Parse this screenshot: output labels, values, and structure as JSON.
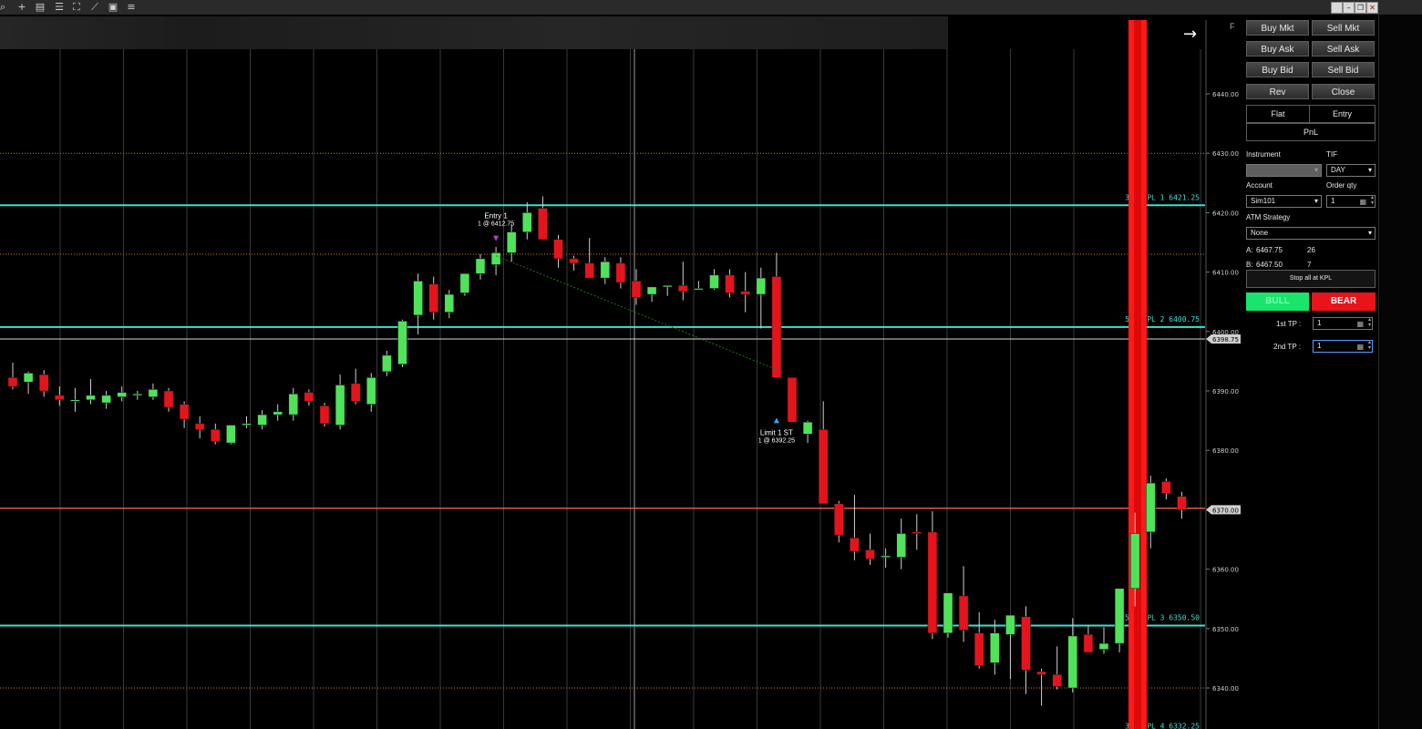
{
  "toolbar": {
    "icons": [
      "search-icon",
      "crosshair-icon",
      "document-icon",
      "properties-icon",
      "zoom-icon",
      "draw-icon",
      "print-icon",
      "list-icon"
    ]
  },
  "chart_data": {
    "type": "candlestick",
    "price_axis": {
      "ticks": [
        "6440.00",
        "6430.00",
        "6420.00",
        "6410.00",
        "6400.00",
        "6390.00",
        "6380.00",
        "6370.00",
        "6360.00",
        "6350.00",
        "6340.00"
      ],
      "range": [
        6328,
        6450
      ],
      "markers": [
        {
          "label": "6398.75",
          "price": 6398.75
        },
        {
          "label": "6370.00",
          "price": 6370.0
        }
      ]
    },
    "candles": [
      {
        "o": 6392.25,
        "h": 6394.75,
        "l": 6390.25,
        "c": 6390.75
      },
      {
        "o": 6391.5,
        "h": 6393.25,
        "l": 6389.5,
        "c": 6393.0
      },
      {
        "o": 6392.75,
        "h": 6393.5,
        "l": 6389.0,
        "c": 6390.0
      },
      {
        "o": 6389.25,
        "h": 6390.75,
        "l": 6387.5,
        "c": 6388.5
      },
      {
        "o": 6388.5,
        "h": 6390.5,
        "l": 6386.5,
        "c": 6388.5
      },
      {
        "o": 6388.5,
        "h": 6392.0,
        "l": 6387.75,
        "c": 6389.25
      },
      {
        "o": 6388.0,
        "h": 6390.0,
        "l": 6387.0,
        "c": 6389.25
      },
      {
        "o": 6389.0,
        "h": 6390.75,
        "l": 6388.25,
        "c": 6389.75
      },
      {
        "o": 6389.25,
        "h": 6390.0,
        "l": 6388.5,
        "c": 6389.5
      },
      {
        "o": 6389.0,
        "h": 6391.25,
        "l": 6388.5,
        "c": 6390.25
      },
      {
        "o": 6390.0,
        "h": 6390.5,
        "l": 6386.5,
        "c": 6387.25
      },
      {
        "o": 6387.75,
        "h": 6388.25,
        "l": 6383.75,
        "c": 6385.25
      },
      {
        "o": 6384.5,
        "h": 6385.75,
        "l": 6382.0,
        "c": 6383.5
      },
      {
        "o": 6383.5,
        "h": 6384.5,
        "l": 6381.0,
        "c": 6381.5
      },
      {
        "o": 6381.25,
        "h": 6384.25,
        "l": 6381.0,
        "c": 6384.25
      },
      {
        "o": 6384.25,
        "h": 6385.75,
        "l": 6383.75,
        "c": 6384.5
      },
      {
        "o": 6384.25,
        "h": 6386.75,
        "l": 6383.5,
        "c": 6386.0
      },
      {
        "o": 6386.0,
        "h": 6387.75,
        "l": 6385.0,
        "c": 6386.5
      },
      {
        "o": 6386.0,
        "h": 6390.5,
        "l": 6385.0,
        "c": 6389.5
      },
      {
        "o": 6389.75,
        "h": 6390.25,
        "l": 6387.5,
        "c": 6388.25
      },
      {
        "o": 6387.5,
        "h": 6388.0,
        "l": 6384.0,
        "c": 6384.5
      },
      {
        "o": 6384.25,
        "h": 6392.75,
        "l": 6383.5,
        "c": 6391.0
      },
      {
        "o": 6391.25,
        "h": 6393.75,
        "l": 6387.75,
        "c": 6388.25
      },
      {
        "o": 6387.75,
        "h": 6393.0,
        "l": 6386.5,
        "c": 6392.25
      },
      {
        "o": 6393.25,
        "h": 6396.75,
        "l": 6392.5,
        "c": 6396.0
      },
      {
        "o": 6394.5,
        "h": 6402.0,
        "l": 6394.0,
        "c": 6401.75
      },
      {
        "o": 6402.75,
        "h": 6409.75,
        "l": 6399.5,
        "c": 6408.5
      },
      {
        "o": 6408.0,
        "h": 6409.25,
        "l": 6402.0,
        "c": 6403.25
      },
      {
        "o": 6403.25,
        "h": 6407.0,
        "l": 6402.25,
        "c": 6406.25
      },
      {
        "o": 6406.5,
        "h": 6409.0,
        "l": 6406.0,
        "c": 6409.75
      },
      {
        "o": 6409.75,
        "h": 6413.0,
        "l": 6408.75,
        "c": 6412.25
      },
      {
        "o": 6411.25,
        "h": 6414.25,
        "l": 6409.5,
        "c": 6413.25
      },
      {
        "o": 6413.25,
        "h": 6418.0,
        "l": 6411.75,
        "c": 6416.75
      },
      {
        "o": 6416.75,
        "h": 6421.75,
        "l": 6415.5,
        "c": 6420.0
      },
      {
        "o": 6420.75,
        "h": 6422.75,
        "l": 6416.25,
        "c": 6415.5
      },
      {
        "o": 6415.5,
        "h": 6416.25,
        "l": 6410.75,
        "c": 6412.25
      },
      {
        "o": 6412.25,
        "h": 6412.75,
        "l": 6410.25,
        "c": 6411.5
      },
      {
        "o": 6411.5,
        "h": 6415.75,
        "l": 6409.0,
        "c": 6409.0
      },
      {
        "o": 6409.0,
        "h": 6412.5,
        "l": 6408.0,
        "c": 6411.75
      },
      {
        "o": 6411.5,
        "h": 6412.5,
        "l": 6407.25,
        "c": 6408.25
      },
      {
        "o": 6408.5,
        "h": 6410.5,
        "l": 6404.5,
        "c": 6405.75
      },
      {
        "o": 6406.25,
        "h": 6407.5,
        "l": 6405.0,
        "c": 6407.5
      },
      {
        "o": 6407.5,
        "h": 6407.75,
        "l": 6406.0,
        "c": 6407.75
      },
      {
        "o": 6407.75,
        "h": 6411.75,
        "l": 6405.25,
        "c": 6406.75
      },
      {
        "o": 6407.25,
        "h": 6408.5,
        "l": 6407.25,
        "c": 6407.25
      },
      {
        "o": 6407.25,
        "h": 6410.5,
        "l": 6407.0,
        "c": 6409.5
      },
      {
        "o": 6409.5,
        "h": 6410.5,
        "l": 6405.75,
        "c": 6406.5
      },
      {
        "o": 6406.75,
        "h": 6410.0,
        "l": 6403.25,
        "c": 6406.25
      },
      {
        "o": 6406.25,
        "h": 6410.75,
        "l": 6400.5,
        "c": 6409.0
      },
      {
        "o": 6409.25,
        "h": 6413.25,
        "l": 6392.25,
        "c": 6392.25
      },
      {
        "o": 6392.25,
        "h": 6392.25,
        "l": 6384.75,
        "c": 6384.75
      },
      {
        "o": 6382.75,
        "h": 6385.0,
        "l": 6381.25,
        "c": 6384.75
      },
      {
        "o": 6383.5,
        "h": 6388.25,
        "l": 6371.0,
        "c": 6371.0
      },
      {
        "o": 6371.0,
        "h": 6371.5,
        "l": 6364.5,
        "c": 6365.75
      },
      {
        "o": 6365.25,
        "h": 6372.5,
        "l": 6361.5,
        "c": 6363.0
      },
      {
        "o": 6363.25,
        "h": 6366.0,
        "l": 6360.75,
        "c": 6361.75
      },
      {
        "o": 6362.0,
        "h": 6363.5,
        "l": 6360.25,
        "c": 6362.25
      },
      {
        "o": 6362.0,
        "h": 6368.5,
        "l": 6360.0,
        "c": 6366.0
      },
      {
        "o": 6366.25,
        "h": 6369.25,
        "l": 6363.25,
        "c": 6366.0
      },
      {
        "o": 6366.25,
        "h": 6369.75,
        "l": 6348.25,
        "c": 6349.25
      },
      {
        "o": 6349.25,
        "h": 6356.0,
        "l": 6348.5,
        "c": 6356.0
      },
      {
        "o": 6355.5,
        "h": 6360.5,
        "l": 6347.75,
        "c": 6349.75
      },
      {
        "o": 6349.25,
        "h": 6352.75,
        "l": 6343.25,
        "c": 6343.75
      },
      {
        "o": 6344.25,
        "h": 6351.5,
        "l": 6342.25,
        "c": 6349.25
      },
      {
        "o": 6349.0,
        "h": 6352.0,
        "l": 6341.5,
        "c": 6352.25
      },
      {
        "o": 6352.0,
        "h": 6353.75,
        "l": 6339.0,
        "c": 6343.0
      },
      {
        "o": 6342.75,
        "h": 6343.25,
        "l": 6337.0,
        "c": 6342.25
      },
      {
        "o": 6342.25,
        "h": 6347.0,
        "l": 6339.75,
        "c": 6340.25
      },
      {
        "o": 6340.0,
        "h": 6351.75,
        "l": 6339.25,
        "c": 6348.75
      },
      {
        "o": 6349.0,
        "h": 6350.5,
        "l": 6346.25,
        "c": 6346.0
      },
      {
        "o": 6346.5,
        "h": 6350.25,
        "l": 6345.75,
        "c": 6347.5
      },
      {
        "o": 6347.5,
        "h": 6355.25,
        "l": 6346.0,
        "c": 6356.75
      },
      {
        "o": 6356.75,
        "h": 6369.5,
        "l": 6353.75,
        "c": 6366.0
      },
      {
        "o": 6366.25,
        "h": 6375.75,
        "l": 6363.5,
        "c": 6374.5
      },
      {
        "o": 6374.75,
        "h": 6375.25,
        "l": 6371.75,
        "c": 6372.75
      },
      {
        "o": 6372.25,
        "h": 6373.0,
        "l": 6368.5,
        "c": 6370.0
      }
    ],
    "kpl_levels": [
      {
        "label": "32% KPL 1 6421.25",
        "price": 6421.25
      },
      {
        "label": "59% KPL 2 6400.75",
        "price": 6400.75
      },
      {
        "label": "55% KPL 3 6350.50",
        "price": 6350.5
      },
      {
        "label": "32% KPL 4 6332.25",
        "price": 6332.25
      }
    ],
    "dotted_levels": [
      6430.0,
      6413.0,
      6340.0
    ],
    "solid_levels": [
      6398.75
    ],
    "current_price_line": {
      "price": 6370.25,
      "label": "6370.00"
    },
    "order_markers": [
      {
        "label": "Entry 1",
        "detail": "1 @ 6412.75",
        "price": 6412.75
      },
      {
        "label": "Limit 1 ST",
        "detail": "1 @ 6392.25",
        "price": 6392.25
      }
    ],
    "grid": true,
    "highlight_band": "red vertical band near right edge"
  },
  "panel": {
    "buttons": [
      "Buy Mkt",
      "Sell Mkt",
      "Buy Ask",
      "Sell Ask",
      "Buy Bid",
      "Sell Bid",
      "Rev",
      "Close"
    ],
    "tabs": [
      "Flat",
      "Entry"
    ],
    "pnl_label": "PnL",
    "instrument_label": "Instrument",
    "instrument_value": "",
    "tif_label": "TIF",
    "tif_value": "DAY",
    "account_label": "Account",
    "account_value": "Sim101",
    "order_qty_label": "Order qty",
    "order_qty_value": "1",
    "atm_label": "ATM Strategy",
    "atm_value": "None",
    "ask_label": "A:",
    "ask_price": "6467.75",
    "ask_size": "26",
    "bid_label": "B:",
    "bid_price": "6467.50",
    "bid_size": "7",
    "stop_button": "Stop all at KPL",
    "bull_label": "BULL",
    "bear_label": "BEAR",
    "tp1_label": "1st TP :",
    "tp1_value": "1",
    "tp2_label": "2nd TP :",
    "tp2_value": "1"
  },
  "chart_header": {
    "f_button": "F",
    "arrow_icon": "arrow-right-icon"
  },
  "colors": {
    "up": "#4fe35a",
    "down": "#e5141c",
    "kpl": "#3fe0d0",
    "band": "#ff1010",
    "bull": "#19e56a",
    "bear": "#e8141a"
  }
}
